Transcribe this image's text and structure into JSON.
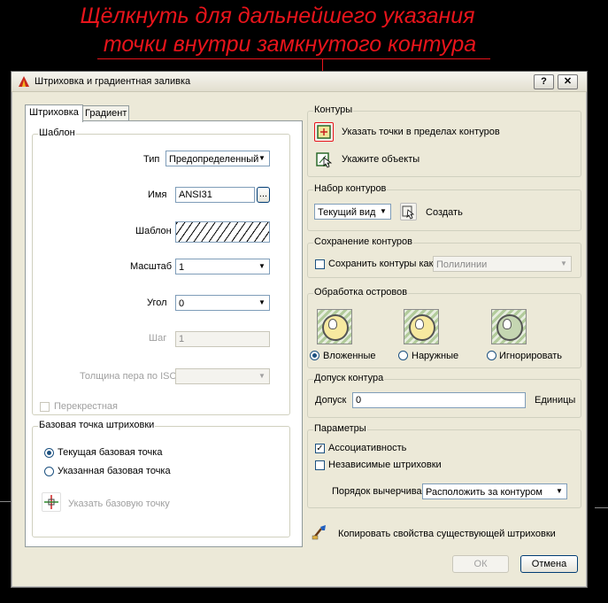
{
  "annotation": {
    "line1": "Щёлкнуть для дальнейшего указания",
    "line2": "точки внутри замкнутого контура"
  },
  "window": {
    "title": "Штриховка и градиентная заливка",
    "help_label": "?",
    "close_label": "✕"
  },
  "tabs": [
    {
      "label": "Штриховка",
      "active": true
    },
    {
      "label": "Градиент",
      "active": false
    }
  ],
  "template": {
    "group_label": "Шаблон",
    "type_label": "Тип",
    "type_value": "Предопределенный",
    "name_label": "Имя",
    "name_value": "ANSI31",
    "browse_label": "...",
    "pattern_label": "Шаблон",
    "scale_label": "Масштаб",
    "scale_value": "1",
    "angle_label": "Угол",
    "angle_value": "0",
    "step_label": "Шаг",
    "step_value": "1",
    "iso_label": "Толщина пера по ISO",
    "cross_label": "Перекрестная"
  },
  "base_point": {
    "group_label": "Базовая точка штриховки",
    "current_label": "Текущая базовая точка",
    "specified_label": "Указанная базовая точка",
    "specify_button_label": "Указать базовую точку"
  },
  "contours": {
    "group_label": "Контуры",
    "pick_points_label": "Указать точки в пределах контуров",
    "select_objects_label": "Укажите объекты"
  },
  "boundary_set": {
    "group_label": "Набор контуров",
    "combo_value": "Текущий вид",
    "create_label": "Создать"
  },
  "retain": {
    "group_label": "Сохранение контуров",
    "checkbox_label": "Сохранить контуры как",
    "combo_value": "Полилинии"
  },
  "islands": {
    "group_label": "Обработка островов",
    "options": [
      {
        "label": "Вложенные",
        "selected": true
      },
      {
        "label": "Наружные",
        "selected": false
      },
      {
        "label": "Игнорировать",
        "selected": false
      }
    ]
  },
  "tolerance": {
    "group_label": "Допуск контура",
    "label": "Допуск",
    "value": "0",
    "units": "Единицы"
  },
  "params": {
    "group_label": "Параметры",
    "associative_label": "Ассоциативность",
    "associative_checked": true,
    "separate_label": "Независимые штриховки",
    "separate_checked": false,
    "draw_order_label": "Порядок вычерчивания",
    "draw_order_value": "Расположить за контуром"
  },
  "inherit_label": "Копировать свойства существующей штриховки",
  "ok_label": "ОК",
  "cancel_label": "Отмена",
  "colors": {
    "annotation": "#e8141b",
    "dialog_bg": "#ece9d8",
    "highlight": "#e8141b"
  },
  "icons": {
    "app": "autocad-logo-icon",
    "pick_points": "pick-points-icon",
    "select_objects": "select-objects-icon",
    "create": "create-boundary-icon",
    "base_point": "crosshair-icon",
    "inherit": "inherit-brush-icon"
  }
}
